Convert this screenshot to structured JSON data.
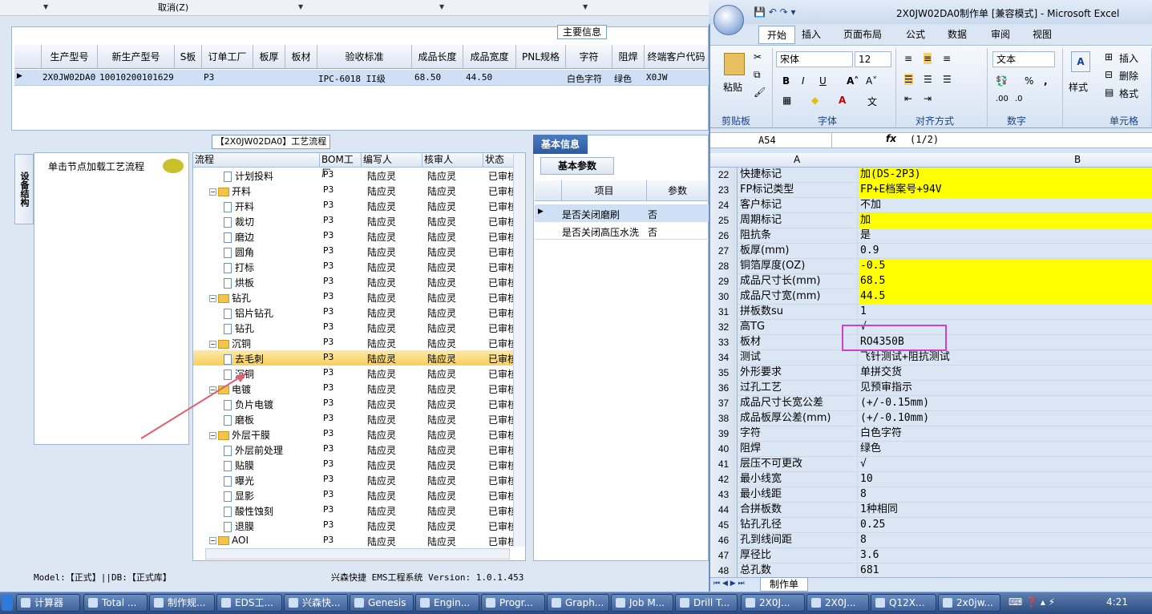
{
  "top": {
    "cancel": "取消(Z)",
    "main_info": "主要信息"
  },
  "grid": {
    "headers": [
      "生产型号",
      "新生产型号",
      "S板",
      "订单工厂",
      "板厚",
      "板材",
      "验收标准",
      "成品长度",
      "成品宽度",
      "PNL规格",
      "字符",
      "阻焊",
      "终端客户代码"
    ],
    "row": {
      "prod": "2X0JW02DA0",
      "newprod": "10010200101629",
      "factory": "P3",
      "std": "IPC-6018 II级",
      "len": "68.50",
      "wid": "44.50",
      "char": "白色字符",
      "mask": "绿色",
      "cust": "X0JW"
    }
  },
  "flow": {
    "title": "【2X0JW02DA0】工艺流程",
    "side_tab": "设备结构",
    "hint": "单击节点加载工艺流程",
    "headers": [
      "流程",
      "BOM工厂",
      "编写人",
      "核审人",
      "状态"
    ],
    "rows": [
      {
        "name": "计划投料",
        "lvl": 1,
        "bom": "P3",
        "w": "陆应灵",
        "r": "陆应灵",
        "s": "已审核"
      },
      {
        "name": "开料",
        "lvl": 0,
        "bom": "P3",
        "w": "陆应灵",
        "r": "陆应灵",
        "s": "已审核"
      },
      {
        "name": "开料",
        "lvl": 1,
        "bom": "P3",
        "w": "陆应灵",
        "r": "陆应灵",
        "s": "已审核"
      },
      {
        "name": "裁切",
        "lvl": 1,
        "bom": "P3",
        "w": "陆应灵",
        "r": "陆应灵",
        "s": "已审核"
      },
      {
        "name": "磨边",
        "lvl": 1,
        "bom": "P3",
        "w": "陆应灵",
        "r": "陆应灵",
        "s": "已审核"
      },
      {
        "name": "圆角",
        "lvl": 1,
        "bom": "P3",
        "w": "陆应灵",
        "r": "陆应灵",
        "s": "已审核"
      },
      {
        "name": "打标",
        "lvl": 1,
        "bom": "P3",
        "w": "陆应灵",
        "r": "陆应灵",
        "s": "已审核"
      },
      {
        "name": "烘板",
        "lvl": 1,
        "bom": "P3",
        "w": "陆应灵",
        "r": "陆应灵",
        "s": "已审核"
      },
      {
        "name": "钻孔",
        "lvl": 0,
        "bom": "P3",
        "w": "陆应灵",
        "r": "陆应灵",
        "s": "已审核"
      },
      {
        "name": "铝片钻孔",
        "lvl": 1,
        "bom": "P3",
        "w": "陆应灵",
        "r": "陆应灵",
        "s": "已审核"
      },
      {
        "name": "钻孔",
        "lvl": 1,
        "bom": "P3",
        "w": "陆应灵",
        "r": "陆应灵",
        "s": "已审核"
      },
      {
        "name": "沉铜",
        "lvl": 0,
        "bom": "P3",
        "w": "陆应灵",
        "r": "陆应灵",
        "s": "已审核"
      },
      {
        "name": "去毛刺",
        "lvl": 1,
        "bom": "P3",
        "w": "陆应灵",
        "r": "陆应灵",
        "s": "已审核",
        "sel": true
      },
      {
        "name": "沉铜",
        "lvl": 1,
        "bom": "P3",
        "w": "陆应灵",
        "r": "陆应灵",
        "s": "已审核"
      },
      {
        "name": "电镀",
        "lvl": 0,
        "bom": "P3",
        "w": "陆应灵",
        "r": "陆应灵",
        "s": "已审核"
      },
      {
        "name": "负片电镀",
        "lvl": 1,
        "bom": "P3",
        "w": "陆应灵",
        "r": "陆应灵",
        "s": "已审核"
      },
      {
        "name": "磨板",
        "lvl": 1,
        "bom": "P3",
        "w": "陆应灵",
        "r": "陆应灵",
        "s": "已审核"
      },
      {
        "name": "外层干膜",
        "lvl": 0,
        "bom": "P3",
        "w": "陆应灵",
        "r": "陆应灵",
        "s": "已审核"
      },
      {
        "name": "外层前处理",
        "lvl": 1,
        "bom": "P3",
        "w": "陆应灵",
        "r": "陆应灵",
        "s": "已审核"
      },
      {
        "name": "贴膜",
        "lvl": 1,
        "bom": "P3",
        "w": "陆应灵",
        "r": "陆应灵",
        "s": "已审核"
      },
      {
        "name": "曝光",
        "lvl": 1,
        "bom": "P3",
        "w": "陆应灵",
        "r": "陆应灵",
        "s": "已审核"
      },
      {
        "name": "显影",
        "lvl": 1,
        "bom": "P3",
        "w": "陆应灵",
        "r": "陆应灵",
        "s": "已审核"
      },
      {
        "name": "酸性蚀刻",
        "lvl": 1,
        "bom": "P3",
        "w": "陆应灵",
        "r": "陆应灵",
        "s": "已审核"
      },
      {
        "name": "退膜",
        "lvl": 1,
        "bom": "P3",
        "w": "陆应灵",
        "r": "陆应灵",
        "s": "已审核"
      },
      {
        "name": "AOI",
        "lvl": 0,
        "bom": "P3",
        "w": "陆应灵",
        "r": "陆应灵",
        "s": "已审核"
      }
    ]
  },
  "basic": {
    "tab": "基本信息",
    "subtab": "基本参数",
    "headers": [
      "项目",
      "参数"
    ],
    "rows": [
      {
        "item": "是否关闭磨刷",
        "val": "否"
      },
      {
        "item": "是否关闭高压水洗",
        "val": "否"
      }
    ]
  },
  "status": {
    "left": "Model:【正式】||DB:【正式库】",
    "center": "兴森快捷 EMS工程系统 Version: 1.0.1.453"
  },
  "excel": {
    "title": "2X0JW02DA0制作单 [兼容模式] - Microsoft Excel",
    "tabs": [
      "开始",
      "插入",
      "页面布局",
      "公式",
      "数据",
      "审阅",
      "视图"
    ],
    "font": "宋体",
    "size": "12",
    "numfmt": "文本",
    "groups": [
      "剪贴板",
      "字体",
      "对齐方式",
      "数字",
      "单元格"
    ],
    "buttons": {
      "paste": "粘贴",
      "styles": "样式",
      "insert": "插入",
      "delete": "删除",
      "format": "格式"
    },
    "namebox": "A54",
    "formula": "(1/2)",
    "cols": [
      "A",
      "B"
    ],
    "rows": [
      {
        "n": "22",
        "a": "快捷标记",
        "b": "加(DS-2P3)",
        "y": true
      },
      {
        "n": "23",
        "a": "FP标记类型",
        "b": "FP+E档案号+94V",
        "y": true
      },
      {
        "n": "24",
        "a": "客户标记",
        "b": "不加"
      },
      {
        "n": "25",
        "a": "周期标记",
        "b": "加",
        "y": true
      },
      {
        "n": "26",
        "a": "阻抗条",
        "b": "是"
      },
      {
        "n": "27",
        "a": "板厚(mm)",
        "b": "0.9"
      },
      {
        "n": "28",
        "a": "铜箔厚度(OZ)",
        "b": "-0.5",
        "y": true
      },
      {
        "n": "29",
        "a": "成品尺寸长(mm)",
        "b": "68.5",
        "y": true
      },
      {
        "n": "30",
        "a": "成品尺寸宽(mm)",
        "b": "44.5",
        "y": true
      },
      {
        "n": "31",
        "a": "拼板数su",
        "b": "1"
      },
      {
        "n": "32",
        "a": "高TG",
        "b": "√"
      },
      {
        "n": "33",
        "a": "板材",
        "b": "RO4350B"
      },
      {
        "n": "34",
        "a": "测试",
        "b": "飞针测试+阻抗测试"
      },
      {
        "n": "35",
        "a": "外形要求",
        "b": "单拼交货"
      },
      {
        "n": "36",
        "a": "过孔工艺",
        "b": "见预审指示"
      },
      {
        "n": "37",
        "a": "成品尺寸长宽公差",
        "b": "(+/-0.15mm)"
      },
      {
        "n": "38",
        "a": "成品板厚公差(mm)",
        "b": "(+/-0.10mm)"
      },
      {
        "n": "39",
        "a": "字符",
        "b": "白色字符"
      },
      {
        "n": "40",
        "a": "阻焊",
        "b": "绿色"
      },
      {
        "n": "41",
        "a": "层压不可更改",
        "b": "√"
      },
      {
        "n": "42",
        "a": "最小线宽",
        "b": "10"
      },
      {
        "n": "43",
        "a": "最小线距",
        "b": "8"
      },
      {
        "n": "44",
        "a": "合拼板数",
        "b": "1种相同"
      },
      {
        "n": "45",
        "a": "钻孔孔径",
        "b": "0.25"
      },
      {
        "n": "46",
        "a": "孔到线间距",
        "b": "8"
      },
      {
        "n": "47",
        "a": "厚径比",
        "b": "3.6"
      },
      {
        "n": "48",
        "a": "总孔数",
        "b": "681"
      }
    ],
    "sheet": "制作单"
  },
  "taskbar": {
    "items": [
      "计算器",
      "Total ...",
      "制作规...",
      "EDS工...",
      "兴森快...",
      "Genesis",
      "Engin...",
      "Progr...",
      "Graph...",
      "Job M...",
      "Drill T...",
      "2X0J...",
      "2X0J...",
      "Q12X...",
      "2x0jw..."
    ],
    "clock": "4:21"
  }
}
